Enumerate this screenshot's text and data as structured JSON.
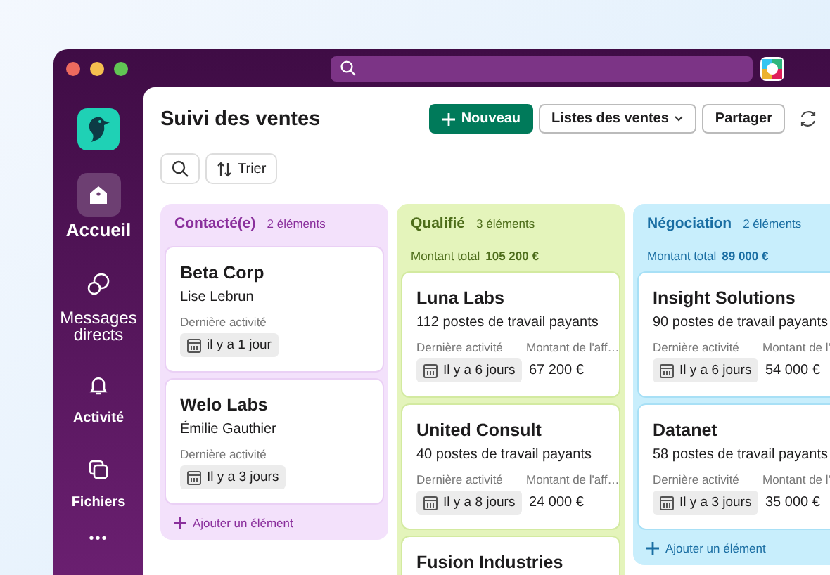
{
  "sidebar": {
    "items": [
      {
        "label": "Accueil",
        "kind": "home",
        "selected": true
      },
      {
        "label": "Messages directs",
        "kind": "messages",
        "selected": false
      },
      {
        "label": "Activité",
        "kind": "bell",
        "selected": false
      },
      {
        "label": "Fichiers",
        "kind": "files",
        "selected": false
      }
    ],
    "more": "•••"
  },
  "header": {
    "title": "Suivi des ventes",
    "buttons": [
      {
        "label": "Nouveau",
        "kind": "primary"
      },
      {
        "label": "Listes des ventes",
        "kind": "dropdown"
      },
      {
        "label": "Partager",
        "kind": "plain"
      }
    ]
  },
  "toolbar": {
    "sort_label": "Trier"
  },
  "columns": [
    {
      "title": "Contacté(e)",
      "count": "2 éléments",
      "color": "#f3e1fb",
      "add_label": "Ajouter un élément",
      "cards": [
        {
          "name": "Beta Corp",
          "subtitle": "Lise Lebrun",
          "activity_label": "Dernière activité",
          "activity": "il y a 1 jour"
        },
        {
          "name": "Welo Labs",
          "subtitle": "Émilie Gauthier",
          "activity_label": "Dernière activité",
          "activity": "Il y a 3 jours"
        }
      ]
    },
    {
      "title": "Qualifié",
      "count": "3 éléments",
      "color": "#e4f4bb",
      "total_label": "Montant total",
      "total": "105 200 €",
      "cards": [
        {
          "name": "Luna Labs",
          "subtitle": "112 postes de travail payants",
          "activity_label": "Dernière activité",
          "activity": "Il y a 6 jours",
          "amount_label": "Montant de l'aff…",
          "amount": "67 200 €"
        },
        {
          "name": "United Consult",
          "subtitle": "40 postes de travail payants",
          "activity_label": "Dernière activité",
          "activity": "Il y a 8 jours",
          "amount_label": "Montant de l'aff…",
          "amount": "24 000 €"
        },
        {
          "name": "Fusion Industries"
        }
      ]
    },
    {
      "title": "Négociation",
      "count": "2 éléments",
      "color": "#c8eefc",
      "total_label": "Montant total",
      "total": "89 000 €",
      "add_label": "Ajouter un élément",
      "cards": [
        {
          "name": "Insight Solutions",
          "subtitle": "90 postes de travail payants",
          "activity_label": "Dernière activité",
          "activity": "Il y a 6 jours",
          "amount_label": "Montant de l'",
          "amount": "54 000 €"
        },
        {
          "name": "Datanet",
          "subtitle": "58 postes de travail payants",
          "activity_label": "Dernière activité",
          "activity": "Il y a 3 jours",
          "amount_label": "Montant de l'",
          "amount": "35 000 €"
        }
      ]
    }
  ]
}
